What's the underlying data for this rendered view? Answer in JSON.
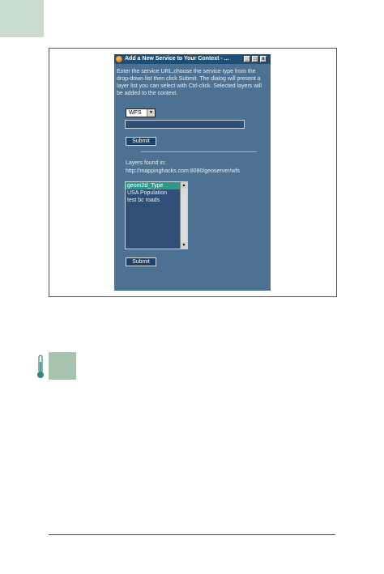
{
  "dialog": {
    "title": "Add a New Service to Your Context - ...",
    "controls": {
      "minimize": "_",
      "maximize": "□",
      "close": "x"
    },
    "instructions": "Enter the service URL,choose the service type from the drop-down list then click Submit. The dialog will present a layer list you can select with Ctrl-click. Selected layers will be added to the context.",
    "service_type": {
      "selected": "WFS"
    },
    "url_input": {
      "value": ""
    },
    "submit_label": "Submit",
    "layers_found_label": "Layers found in:",
    "layers_url": "http://mappinghacks.com:8080/geoserver/wfs",
    "layers": [
      {
        "label": "geom2d_Type",
        "selected": true
      },
      {
        "label": "USA Population",
        "selected": false
      },
      {
        "label": "test bc roads",
        "selected": false
      }
    ],
    "submit_bottom_label": "Submit"
  },
  "colors": {
    "dialog_bg": "#4d7192",
    "titlebar_bg": "#1e4e74",
    "selection": "#2d9b87",
    "corner_tab": "#c9dccd",
    "side_box": "#a8c4ae"
  },
  "icons": [
    "firefox-icon",
    "thermometer-icon"
  ]
}
